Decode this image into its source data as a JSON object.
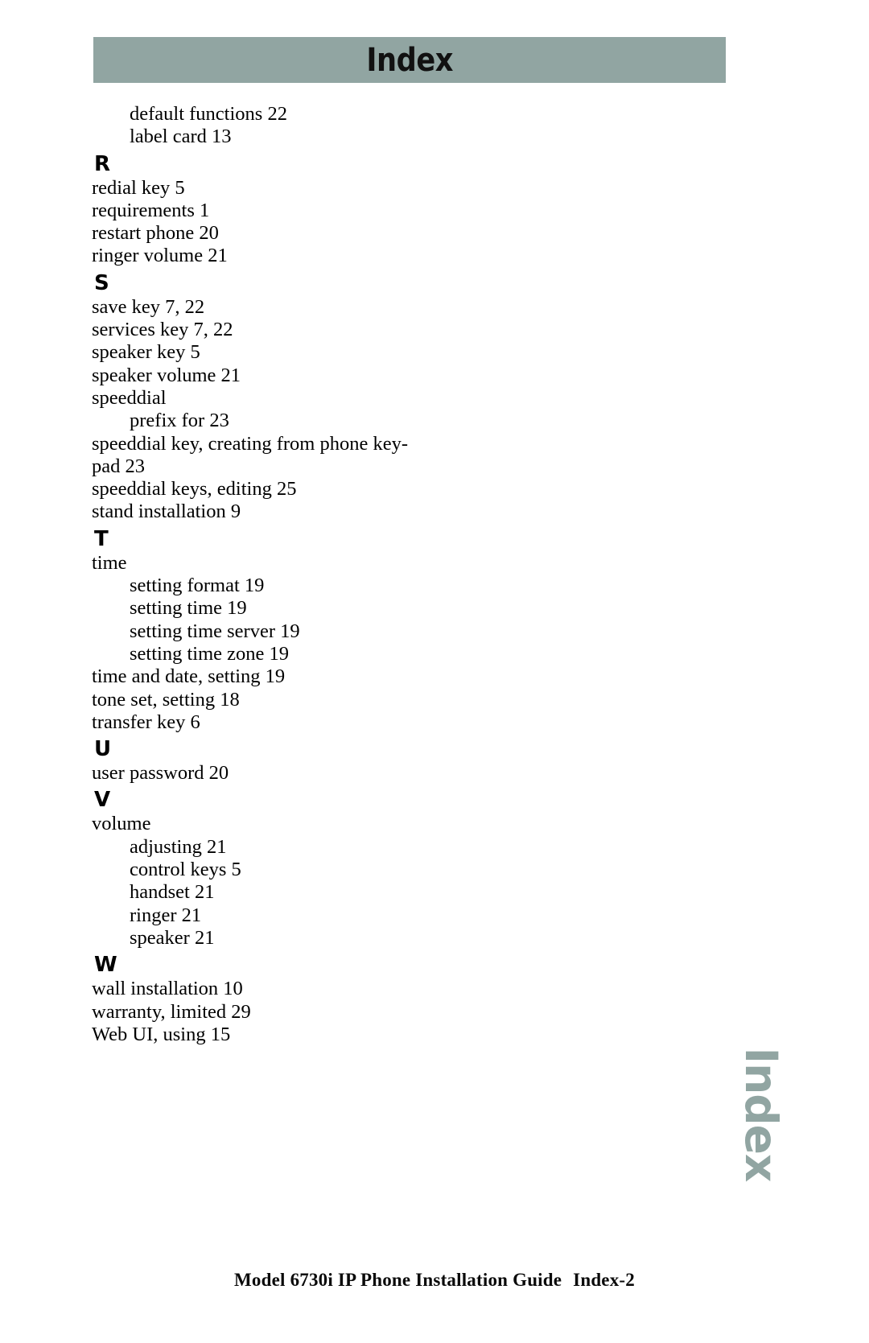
{
  "header": {
    "banner_title": "Index",
    "banner_color": "#91a5a2"
  },
  "side_tab": {
    "label": "Index",
    "color": "#91a5a2"
  },
  "footer": {
    "guide_title": "Model 6730i IP Phone Installation Guide",
    "page_number": "Index-2"
  },
  "index": {
    "lines": [
      {
        "kind": "entry",
        "level": 2,
        "text": "default functions 22"
      },
      {
        "kind": "entry",
        "level": 2,
        "text": "label card 13"
      },
      {
        "kind": "letter",
        "text": "R"
      },
      {
        "kind": "entry",
        "level": 1,
        "text": "redial key 5"
      },
      {
        "kind": "entry",
        "level": 1,
        "text": "requirements 1"
      },
      {
        "kind": "entry",
        "level": 1,
        "text": "restart phone 20"
      },
      {
        "kind": "entry",
        "level": 1,
        "text": "ringer volume 21"
      },
      {
        "kind": "letter",
        "text": "S"
      },
      {
        "kind": "entry",
        "level": 1,
        "text": "save key 7, 22"
      },
      {
        "kind": "entry",
        "level": 1,
        "text": "services key 7, 22"
      },
      {
        "kind": "entry",
        "level": 1,
        "text": "speaker key 5"
      },
      {
        "kind": "entry",
        "level": 1,
        "text": "speaker volume 21"
      },
      {
        "kind": "entry",
        "level": 1,
        "text": "speeddial"
      },
      {
        "kind": "entry",
        "level": 2,
        "text": "prefix for 23"
      },
      {
        "kind": "entry",
        "level": 1,
        "text": "speeddial key, creating from phone key-"
      },
      {
        "kind": "entry",
        "level": 1,
        "text": "pad 23",
        "wrapped": true
      },
      {
        "kind": "entry",
        "level": 1,
        "text": "speeddial keys, editing 25"
      },
      {
        "kind": "entry",
        "level": 1,
        "text": "stand installation 9"
      },
      {
        "kind": "letter",
        "text": "T"
      },
      {
        "kind": "entry",
        "level": 1,
        "text": "time"
      },
      {
        "kind": "entry",
        "level": 2,
        "text": "setting format 19"
      },
      {
        "kind": "entry",
        "level": 2,
        "text": "setting time 19"
      },
      {
        "kind": "entry",
        "level": 2,
        "text": "setting time server 19"
      },
      {
        "kind": "entry",
        "level": 2,
        "text": "setting time zone 19"
      },
      {
        "kind": "entry",
        "level": 1,
        "text": "time and date, setting 19"
      },
      {
        "kind": "entry",
        "level": 1,
        "text": "tone set, setting 18"
      },
      {
        "kind": "entry",
        "level": 1,
        "text": "transfer key 6"
      },
      {
        "kind": "letter",
        "text": "U"
      },
      {
        "kind": "entry",
        "level": 1,
        "text": "user password 20"
      },
      {
        "kind": "letter",
        "text": "V"
      },
      {
        "kind": "entry",
        "level": 1,
        "text": "volume"
      },
      {
        "kind": "entry",
        "level": 2,
        "text": "adjusting 21"
      },
      {
        "kind": "entry",
        "level": 2,
        "text": "control keys 5"
      },
      {
        "kind": "entry",
        "level": 2,
        "text": "handset 21"
      },
      {
        "kind": "entry",
        "level": 2,
        "text": "ringer 21"
      },
      {
        "kind": "entry",
        "level": 2,
        "text": "speaker 21"
      },
      {
        "kind": "letter",
        "text": "W"
      },
      {
        "kind": "entry",
        "level": 1,
        "text": "wall installation 10"
      },
      {
        "kind": "entry",
        "level": 1,
        "text": "warranty, limited 29"
      },
      {
        "kind": "entry",
        "level": 1,
        "text": "Web UI, using 15"
      }
    ]
  }
}
